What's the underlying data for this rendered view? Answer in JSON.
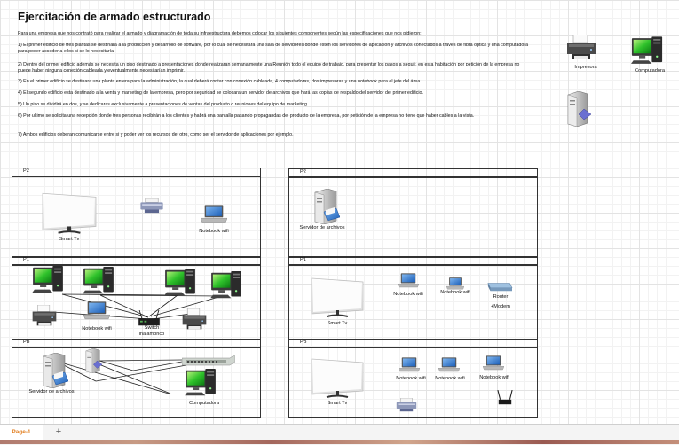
{
  "title": "Ejercitación de armado estructurado",
  "paragraphs": [
    "Para una empresa que  nos contrató para realizar el armado y diagramación de toda su infraestructura debemos colocar los siguientes componentes según las especificaciones que nos pidieron:",
    "1) El primer edificio de tres plantas se destinara a la producción y desarrollo de software, por lo cual se necesitara una sala de servidores donde estén los servidores de aplicación y archivos conectados a través de fibra óptica y una computadora para poder acceder a ellos si se lo necesitaría",
    "2) Dentro del primer edificio además se necesita un piso destinado a presentaciones donde realizaran semanalmente una Reunión todo el equipo de trabajo, para presentar los pasos a seguir, en esta habitación por petición de la empresa no puede haber ninguna conexión cableada y eventualmente necesitarían imprimir.",
    "3) En el primer edificio se destinara una planta entera para la administración, la cual deberá contar con conexión cableada, 4 computadoras, dos impresoras y una notebook para el jefe del área",
    "4) El segundo edificio esta destinado a la venta y marketing de la empresa, pero por seguridad se colocara un servidor de archivos que hará las copias de respaldo del servidor del primer edificio.",
    "5) Un piso se dividirá en dos, y se dedicaras exclusivamente a presentaciones de ventas del producto o reuniones del equipo de marketing",
    "6) Por ultimo se solicita una recepción donde tres personas recibirán a los clientes y habrá una pantalla pasando propagandas del producto de la empresa, por petición de la empresa no tiene que haber cables a la vista.",
    "7) Ambos edificios deberan comunicarse entre si y poder ver los recursos del otro, como ser el servidor de aplicaciones por ejemplo."
  ],
  "palette": {
    "printer": "Impresora",
    "computer": "Computadora"
  },
  "building1": {
    "floors": [
      "P2",
      "P1",
      "PB"
    ],
    "p2": {
      "tv": "Smart Tv",
      "notebook": "Notebook wifi"
    },
    "p1": {
      "notebook": "Notebook wifi",
      "switch": "Switch inalámbrico"
    },
    "pb": {
      "server": "Servidor de archivos",
      "computer": "Computadora"
    }
  },
  "building2": {
    "floors": [
      "P2",
      "P1",
      "PB"
    ],
    "p2": {
      "server": "Servidor de archivos"
    },
    "p1": {
      "tv": "Smart Tv",
      "notebook1": "Notebook wifi",
      "notebook2": "Notebook wifi",
      "router": "Router +Modem"
    },
    "pb": {
      "tv": "Smart Tv",
      "notebook1": "Notebook wifi",
      "notebook2": "Notebook wifi",
      "notebook3": "Notebook wifi"
    }
  },
  "footer": {
    "page_tab": "Page-1",
    "add_icon": "+"
  },
  "icons": [
    "printer-icon",
    "computer-icon",
    "server-icon",
    "tv-icon",
    "notebook-icon",
    "switch-icon",
    "router-icon",
    "access-point-icon",
    "patch-panel-icon"
  ]
}
